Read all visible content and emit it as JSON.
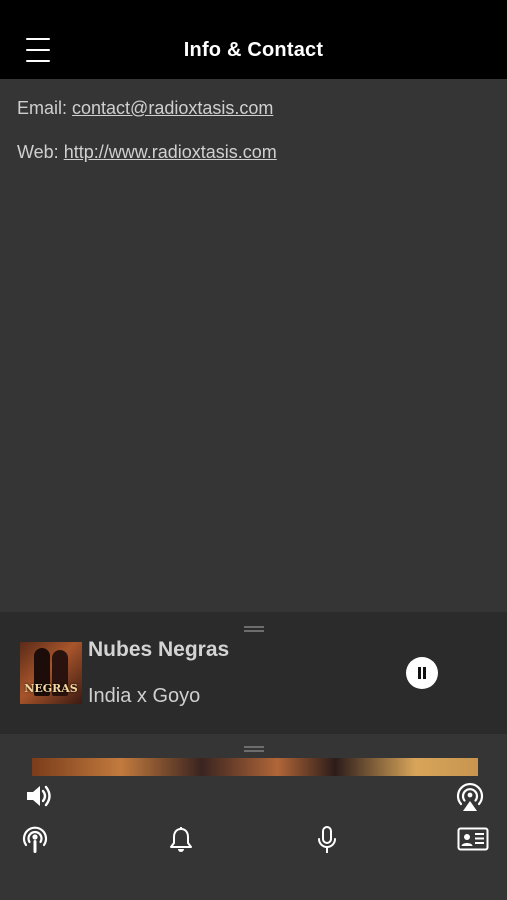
{
  "header": {
    "title": "Info & Contact"
  },
  "contact": {
    "email_label": "Email: ",
    "email_value": "contact@radioxtasis.com",
    "web_label": "Web: ",
    "web_value": "http://www.radioxtasis.com"
  },
  "now_playing": {
    "song": "Nubes Negras",
    "artist": "India x Goyo",
    "art_text": "NEGRAS"
  },
  "bottom_bar": {
    "top_icons": [
      "volume-icon",
      "airplay-icon"
    ],
    "nav_icons": [
      "podcast-icon",
      "bell-icon",
      "microphone-icon",
      "contact-card-icon"
    ]
  },
  "colors": {
    "background": "#353535",
    "header": "#000000",
    "player": "#2b2b2b"
  }
}
